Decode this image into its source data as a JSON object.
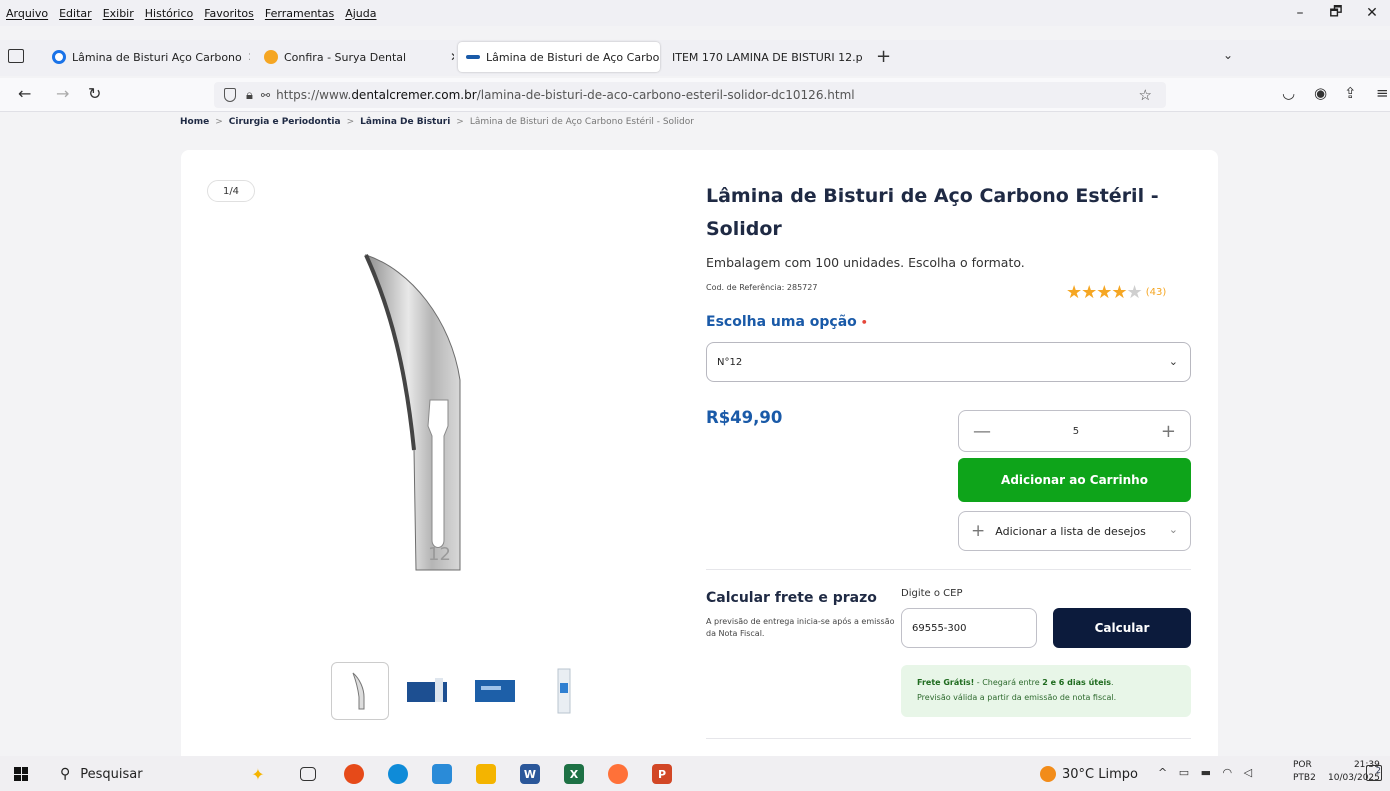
{
  "menu": [
    "Arquivo",
    "Editar",
    "Exibir",
    "Histórico",
    "Favoritos",
    "Ferramentas",
    "Ajuda"
  ],
  "window_controls": {
    "minimize": "–",
    "restore": "🗗",
    "close": "✕"
  },
  "tabs": [
    {
      "title": "Lâmina de Bisturi Aço Carbono",
      "close": "✕",
      "icon": "search-favicon",
      "color": "#1a73e8"
    },
    {
      "title": "Confira - Surya Dental",
      "close": "✕",
      "icon": "surya-favicon",
      "color": "#f5a623"
    },
    {
      "title": "Lâmina de Bisturi de Aço Carbo",
      "close": "✕",
      "icon": "dental-cremer-favicon",
      "color": "#1a5aa8"
    },
    {
      "title": "ITEM 170 LAMINA DE BISTURI 12.p",
      "close": "✕",
      "icon": "none"
    }
  ],
  "new_tab": "+",
  "url": {
    "prefix": "https://www.",
    "domain": "dentalcremer.com.br",
    "path": "/lamina-de-bisturi-de-aco-carbono-esteril-solidor-dc10126.html"
  },
  "breadcrumb": [
    "Home",
    "Cirurgia e Periodontia",
    "Lâmina De Bisturi",
    "Lâmina de Bisturi de Aço Carbono Estéril - Solidor"
  ],
  "product": {
    "image_counter": "1/4",
    "blade_number": "12",
    "title": "Lâmina de Bisturi de Aço Carbono Estéril - Solidor",
    "subtitle": "Embalagem com 100 unidades. Escolha o formato.",
    "ref_code": "Cod. de Referência: 285727",
    "rating_stars": 4,
    "rating_count": "(43)",
    "option_label": "Escolha uma opção",
    "option_required": "•",
    "selected_option": "N°12",
    "price": "R$49,90",
    "quantity": "5",
    "add_to_cart": "Adicionar ao Carrinho",
    "wishlist": "Adicionar a lista de desejos"
  },
  "shipping": {
    "title": "Calcular frete e prazo",
    "note": "A previsão de entrega inicia-se após a emissão da Nota Fiscal.",
    "cep_label": "Digite o CEP",
    "cep_value": "69555-300",
    "calc_button": "Calcular",
    "result_bold": "Frete Grátis!",
    "result_text": " - Chegará entre ",
    "result_days": "2 e 6 dias úteis",
    "result_end": ".",
    "result_line2": "Previsão válida a partir da emissão de nota fiscal."
  },
  "colors": {
    "accent": "#1a5aa8",
    "cart_green": "#0ea41a",
    "navy": "#0c1b3c",
    "star": "#f5a623"
  },
  "taskbar": {
    "search": "Pesquisar",
    "weather": "30°C  Limpo",
    "lang1": "POR",
    "lang2": "PTB2",
    "time": "21:39",
    "date": "10/03/2025",
    "notif_count": "2"
  }
}
